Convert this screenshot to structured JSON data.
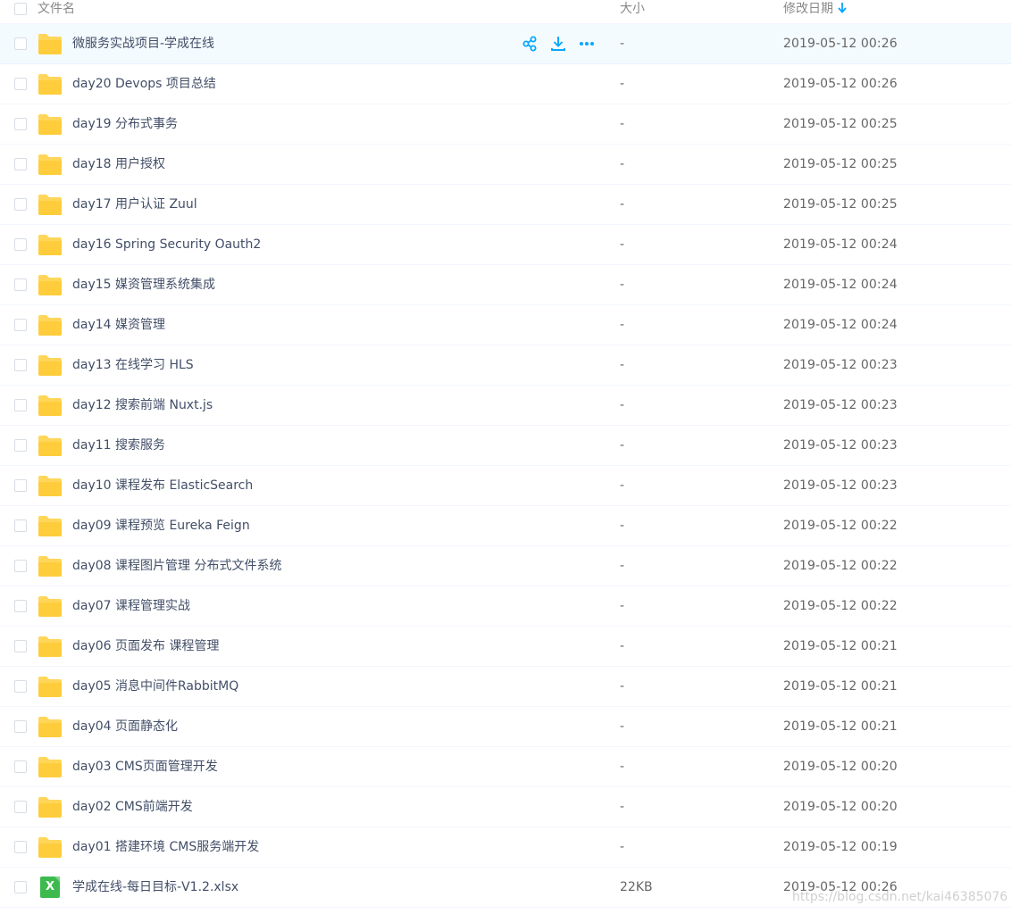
{
  "header": {
    "name_col": "文件名",
    "size_col": "大小",
    "date_col": "修改日期"
  },
  "rows": [
    {
      "name": "微服务实战项目-学成在线",
      "size": "-",
      "date": "2019-05-12 00:26",
      "icon": "folder-icon"
    },
    {
      "name": "day20 Devops 项目总结",
      "size": "-",
      "date": "2019-05-12 00:26",
      "icon": "folder-icon"
    },
    {
      "name": "day19 分布式事务",
      "size": "-",
      "date": "2019-05-12 00:25",
      "icon": "folder-icon"
    },
    {
      "name": "day18 用户授权",
      "size": "-",
      "date": "2019-05-12 00:25",
      "icon": "folder-icon"
    },
    {
      "name": "day17 用户认证 Zuul",
      "size": "-",
      "date": "2019-05-12 00:25",
      "icon": "folder-icon"
    },
    {
      "name": "day16 Spring Security Oauth2",
      "size": "-",
      "date": "2019-05-12 00:24",
      "icon": "folder-icon"
    },
    {
      "name": "day15 媒资管理系统集成",
      "size": "-",
      "date": "2019-05-12 00:24",
      "icon": "folder-icon"
    },
    {
      "name": "day14 媒资管理",
      "size": "-",
      "date": "2019-05-12 00:24",
      "icon": "folder-icon"
    },
    {
      "name": "day13 在线学习 HLS",
      "size": "-",
      "date": "2019-05-12 00:23",
      "icon": "folder-icon"
    },
    {
      "name": "day12 搜索前端 Nuxt.js",
      "size": "-",
      "date": "2019-05-12 00:23",
      "icon": "folder-icon"
    },
    {
      "name": "day11 搜索服务",
      "size": "-",
      "date": "2019-05-12 00:23",
      "icon": "folder-icon"
    },
    {
      "name": "day10 课程发布 ElasticSearch",
      "size": "-",
      "date": "2019-05-12 00:23",
      "icon": "folder-icon"
    },
    {
      "name": "day09 课程预览 Eureka Feign",
      "size": "-",
      "date": "2019-05-12 00:22",
      "icon": "folder-icon"
    },
    {
      "name": "day08 课程图片管理 分布式文件系统",
      "size": "-",
      "date": "2019-05-12 00:22",
      "icon": "folder-icon"
    },
    {
      "name": "day07 课程管理实战",
      "size": "-",
      "date": "2019-05-12 00:22",
      "icon": "folder-icon"
    },
    {
      "name": "day06 页面发布 课程管理",
      "size": "-",
      "date": "2019-05-12 00:21",
      "icon": "folder-icon"
    },
    {
      "name": "day05 消息中间件RabbitMQ",
      "size": "-",
      "date": "2019-05-12 00:21",
      "icon": "folder-icon"
    },
    {
      "name": "day04 页面静态化",
      "size": "-",
      "date": "2019-05-12 00:21",
      "icon": "folder-icon"
    },
    {
      "name": "day03 CMS页面管理开发",
      "size": "-",
      "date": "2019-05-12 00:20",
      "icon": "folder-icon"
    },
    {
      "name": "day02 CMS前端开发",
      "size": "-",
      "date": "2019-05-12 00:20",
      "icon": "folder-icon"
    },
    {
      "name": "day01 搭建环境 CMS服务端开发",
      "size": "-",
      "date": "2019-05-12 00:19",
      "icon": "folder-icon"
    },
    {
      "name": "学成在线-每日目标-V1.2.xlsx",
      "size": "22KB",
      "date": "2019-05-12 00:26",
      "icon": "excel-file-icon",
      "icon_letter": "X"
    }
  ],
  "watermark": "https://blog.csdn.net/kai46385076",
  "colors": {
    "folder": "#ffd659",
    "accent": "#06a7ff",
    "excel": "#3dba4e",
    "hover_row": "#f4fbff"
  }
}
